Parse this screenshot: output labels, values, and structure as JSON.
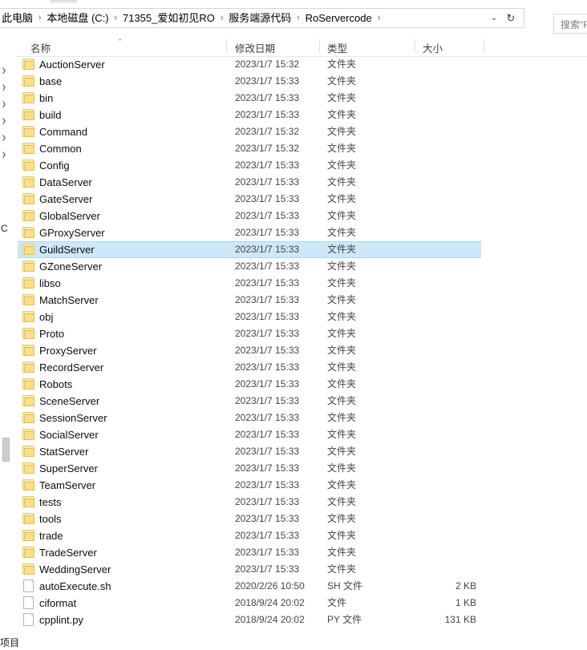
{
  "window": {
    "app": "File Explorer"
  },
  "address_bar": {
    "breadcrumbs": [
      "此电脑",
      "本地磁盘 (C:)",
      "71355_爱如初见RO",
      "服务端源代码",
      "RoServercode"
    ],
    "separator": "›",
    "dropdown_icon": "chevron-down-icon",
    "dropdown_glyph": "⌄",
    "refresh_icon": "refresh-icon",
    "refresh_glyph": "↻"
  },
  "search": {
    "placeholder": "搜索\"R"
  },
  "columns": {
    "name": "名称",
    "date_modified": "修改日期",
    "type": "类型",
    "size": "大小",
    "sort_caret": "⌃"
  },
  "nav_pane": {
    "letter_fragment": "C"
  },
  "status_bar": {
    "text": "项目"
  },
  "files": [
    {
      "name": "AuctionServer",
      "date": "2023/1/7 15:32",
      "type": "文件夹",
      "size": "",
      "kind": "folder",
      "selected": false
    },
    {
      "name": "base",
      "date": "2023/1/7 15:33",
      "type": "文件夹",
      "size": "",
      "kind": "folder",
      "selected": false
    },
    {
      "name": "bin",
      "date": "2023/1/7 15:33",
      "type": "文件夹",
      "size": "",
      "kind": "folder",
      "selected": false
    },
    {
      "name": "build",
      "date": "2023/1/7 15:33",
      "type": "文件夹",
      "size": "",
      "kind": "folder",
      "selected": false
    },
    {
      "name": "Command",
      "date": "2023/1/7 15:32",
      "type": "文件夹",
      "size": "",
      "kind": "folder",
      "selected": false
    },
    {
      "name": "Common",
      "date": "2023/1/7 15:32",
      "type": "文件夹",
      "size": "",
      "kind": "folder",
      "selected": false
    },
    {
      "name": "Config",
      "date": "2023/1/7 15:33",
      "type": "文件夹",
      "size": "",
      "kind": "folder",
      "selected": false
    },
    {
      "name": "DataServer",
      "date": "2023/1/7 15:33",
      "type": "文件夹",
      "size": "",
      "kind": "folder",
      "selected": false
    },
    {
      "name": "GateServer",
      "date": "2023/1/7 15:33",
      "type": "文件夹",
      "size": "",
      "kind": "folder",
      "selected": false
    },
    {
      "name": "GlobalServer",
      "date": "2023/1/7 15:33",
      "type": "文件夹",
      "size": "",
      "kind": "folder",
      "selected": false
    },
    {
      "name": "GProxyServer",
      "date": "2023/1/7 15:33",
      "type": "文件夹",
      "size": "",
      "kind": "folder",
      "selected": false
    },
    {
      "name": "GuildServer",
      "date": "2023/1/7 15:33",
      "type": "文件夹",
      "size": "",
      "kind": "folder",
      "selected": true
    },
    {
      "name": "GZoneServer",
      "date": "2023/1/7 15:33",
      "type": "文件夹",
      "size": "",
      "kind": "folder",
      "selected": false
    },
    {
      "name": "libso",
      "date": "2023/1/7 15:33",
      "type": "文件夹",
      "size": "",
      "kind": "folder",
      "selected": false
    },
    {
      "name": "MatchServer",
      "date": "2023/1/7 15:33",
      "type": "文件夹",
      "size": "",
      "kind": "folder",
      "selected": false
    },
    {
      "name": "obj",
      "date": "2023/1/7 15:33",
      "type": "文件夹",
      "size": "",
      "kind": "folder",
      "selected": false
    },
    {
      "name": "Proto",
      "date": "2023/1/7 15:33",
      "type": "文件夹",
      "size": "",
      "kind": "folder",
      "selected": false
    },
    {
      "name": "ProxyServer",
      "date": "2023/1/7 15:33",
      "type": "文件夹",
      "size": "",
      "kind": "folder",
      "selected": false
    },
    {
      "name": "RecordServer",
      "date": "2023/1/7 15:33",
      "type": "文件夹",
      "size": "",
      "kind": "folder",
      "selected": false
    },
    {
      "name": "Robots",
      "date": "2023/1/7 15:33",
      "type": "文件夹",
      "size": "",
      "kind": "folder",
      "selected": false
    },
    {
      "name": "SceneServer",
      "date": "2023/1/7 15:33",
      "type": "文件夹",
      "size": "",
      "kind": "folder",
      "selected": false
    },
    {
      "name": "SessionServer",
      "date": "2023/1/7 15:33",
      "type": "文件夹",
      "size": "",
      "kind": "folder",
      "selected": false
    },
    {
      "name": "SocialServer",
      "date": "2023/1/7 15:33",
      "type": "文件夹",
      "size": "",
      "kind": "folder",
      "selected": false
    },
    {
      "name": "StatServer",
      "date": "2023/1/7 15:33",
      "type": "文件夹",
      "size": "",
      "kind": "folder",
      "selected": false
    },
    {
      "name": "SuperServer",
      "date": "2023/1/7 15:33",
      "type": "文件夹",
      "size": "",
      "kind": "folder",
      "selected": false
    },
    {
      "name": "TeamServer",
      "date": "2023/1/7 15:33",
      "type": "文件夹",
      "size": "",
      "kind": "folder",
      "selected": false
    },
    {
      "name": "tests",
      "date": "2023/1/7 15:33",
      "type": "文件夹",
      "size": "",
      "kind": "folder",
      "selected": false
    },
    {
      "name": "tools",
      "date": "2023/1/7 15:33",
      "type": "文件夹",
      "size": "",
      "kind": "folder",
      "selected": false
    },
    {
      "name": "trade",
      "date": "2023/1/7 15:33",
      "type": "文件夹",
      "size": "",
      "kind": "folder",
      "selected": false
    },
    {
      "name": "TradeServer",
      "date": "2023/1/7 15:33",
      "type": "文件夹",
      "size": "",
      "kind": "folder",
      "selected": false
    },
    {
      "name": "WeddingServer",
      "date": "2023/1/7 15:33",
      "type": "文件夹",
      "size": "",
      "kind": "folder",
      "selected": false
    },
    {
      "name": "autoExecute.sh",
      "date": "2020/2/26 10:50",
      "type": "SH 文件",
      "size": "2 KB",
      "kind": "file",
      "selected": false
    },
    {
      "name": "ciformat",
      "date": "2018/9/24 20:02",
      "type": "文件",
      "size": "1 KB",
      "kind": "file",
      "selected": false
    },
    {
      "name": "cpplint.py",
      "date": "2018/9/24 20:02",
      "type": "PY 文件",
      "size": "131 KB",
      "kind": "file",
      "selected": false
    }
  ],
  "colors": {
    "selection_fill": "#cce8f9",
    "selection_border": "#a8d8f0",
    "folder_body": "#fbdf8c",
    "folder_edge": "#e0bd57",
    "text_primary": "#0d0d0d",
    "text_secondary": "#454545"
  }
}
